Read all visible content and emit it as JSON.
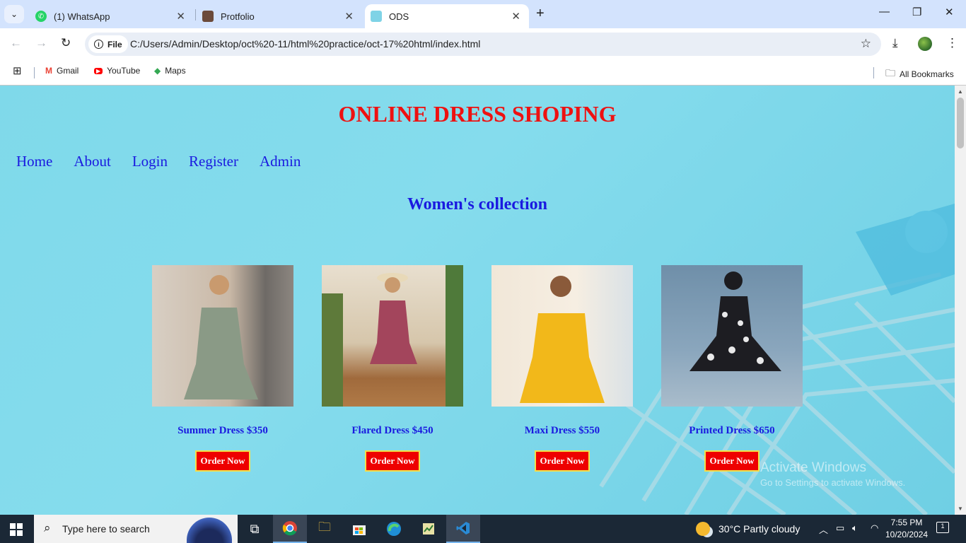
{
  "browser": {
    "tabs": [
      {
        "title": "(1) WhatsApp",
        "icon": "whatsapp-icon"
      },
      {
        "title": "Protfolio",
        "icon": "portfolio-favicon"
      },
      {
        "title": "ODS",
        "icon": "page-favicon",
        "active": true
      }
    ],
    "address": {
      "scheme_chip": "File",
      "url": "C:/Users/Admin/Desktop/oct%20-11/html%20practice/oct-17%20html/index.html"
    },
    "bookmarks": [
      {
        "label": "Gmail",
        "icon": "gmail-icon"
      },
      {
        "label": "YouTube",
        "icon": "youtube-icon"
      },
      {
        "label": "Maps",
        "icon": "maps-icon"
      }
    ],
    "all_bookmarks": "All Bookmarks"
  },
  "page": {
    "site_title": "ONLINE DRESS SHOPING",
    "nav": [
      "Home",
      "About",
      "Login",
      "Register",
      "Admin"
    ],
    "collection_title": "Women's collection",
    "products": [
      {
        "name": "Summer Dress $350",
        "button": "Order Now",
        "dress_color": "#8a9a86"
      },
      {
        "name": "Flared Dress $450",
        "button": "Order Now",
        "dress_color": "#a3455c"
      },
      {
        "name": "Maxi Dress $550",
        "button": "Order Now",
        "dress_color": "#f2b81a"
      },
      {
        "name": "Printed Dress $650",
        "button": "Order Now",
        "dress_color": "#1d1d22"
      }
    ],
    "watermark": {
      "line1": "Activate Windows",
      "line2": "Go to Settings to activate Windows."
    }
  },
  "taskbar": {
    "search_placeholder": "Type here to search",
    "weather": "30°C  Partly cloudy",
    "time": "7:55 PM",
    "date": "10/20/2024",
    "notifications": "1"
  },
  "colors": {
    "page_bg": "#7fd9ea",
    "title_red": "#ee1111",
    "nav_blue": "#1a1ae0",
    "button_red": "#ee0000",
    "button_border": "#f2e14a"
  }
}
